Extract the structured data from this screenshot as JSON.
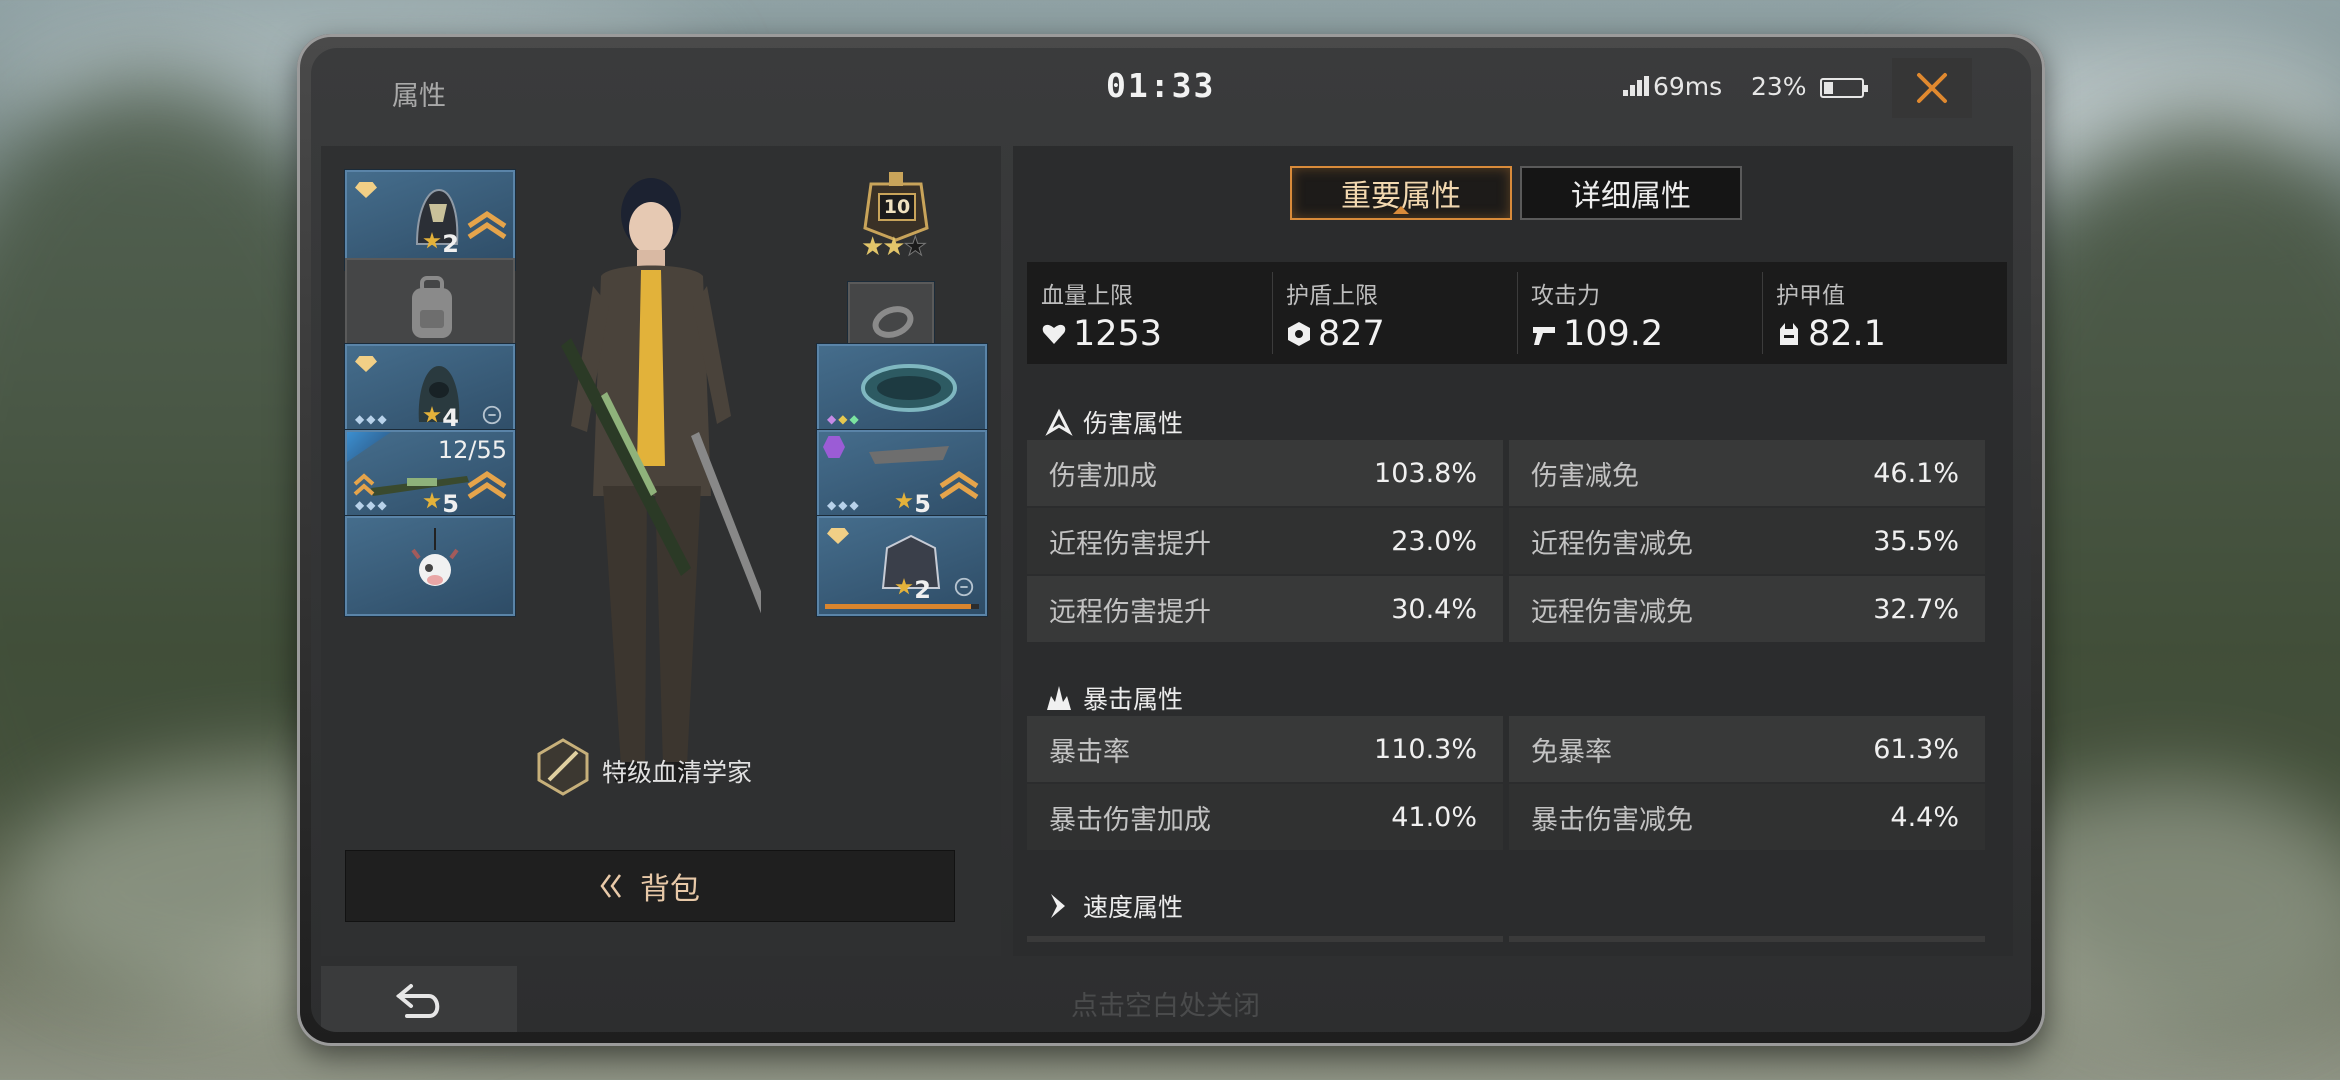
{
  "header": {
    "title": "属性",
    "clock": "01:33",
    "ping": "69ms",
    "battery": "23%"
  },
  "loadout": {
    "slots": [
      {
        "name": "helmet",
        "level": "2"
      },
      {
        "name": "backpack"
      },
      {
        "name": "armor",
        "level": "4"
      },
      {
        "name": "rifle",
        "level": "5",
        "ammo": "12/55"
      },
      {
        "name": "pendant"
      },
      {
        "name": "ring"
      },
      {
        "name": "bracer"
      },
      {
        "name": "blade",
        "level": "5"
      },
      {
        "name": "gauntlet",
        "level": "2"
      }
    ],
    "rank_level": "10",
    "title_text": "特级血清学家",
    "bag_label": "背包"
  },
  "tabs": {
    "important": "重要属性",
    "detailed": "详细属性"
  },
  "summary": [
    {
      "label": "血量上限",
      "value": "1253",
      "icon": "heart-icon"
    },
    {
      "label": "护盾上限",
      "value": "827",
      "icon": "shield-hex-icon"
    },
    {
      "label": "攻击力",
      "value": "109.2",
      "icon": "pistol-icon"
    },
    {
      "label": "护甲值",
      "value": "82.1",
      "icon": "armor-vest-icon"
    }
  ],
  "sections": {
    "damage": {
      "title": "伤害属性",
      "rows": [
        {
          "k": "伤害加成",
          "v": "103.8%"
        },
        {
          "k": "伤害减免",
          "v": "46.1%"
        },
        {
          "k": "近程伤害提升",
          "v": "23.0%"
        },
        {
          "k": "近程伤害减免",
          "v": "35.5%"
        },
        {
          "k": "远程伤害提升",
          "v": "30.4%"
        },
        {
          "k": "远程伤害减免",
          "v": "32.7%"
        }
      ]
    },
    "crit": {
      "title": "暴击属性",
      "rows": [
        {
          "k": "暴击率",
          "v": "110.3%"
        },
        {
          "k": "免暴率",
          "v": "61.3%"
        },
        {
          "k": "暴击伤害加成",
          "v": "41.0%"
        },
        {
          "k": "暴击伤害减免",
          "v": "4.4%"
        }
      ]
    },
    "speed": {
      "title": "速度属性"
    }
  },
  "footer": {
    "hint": "点击空白处关闭"
  },
  "colors": {
    "accent": "#d98b3a",
    "slot_blue": "#456d8c",
    "progress": "#d9852e"
  }
}
